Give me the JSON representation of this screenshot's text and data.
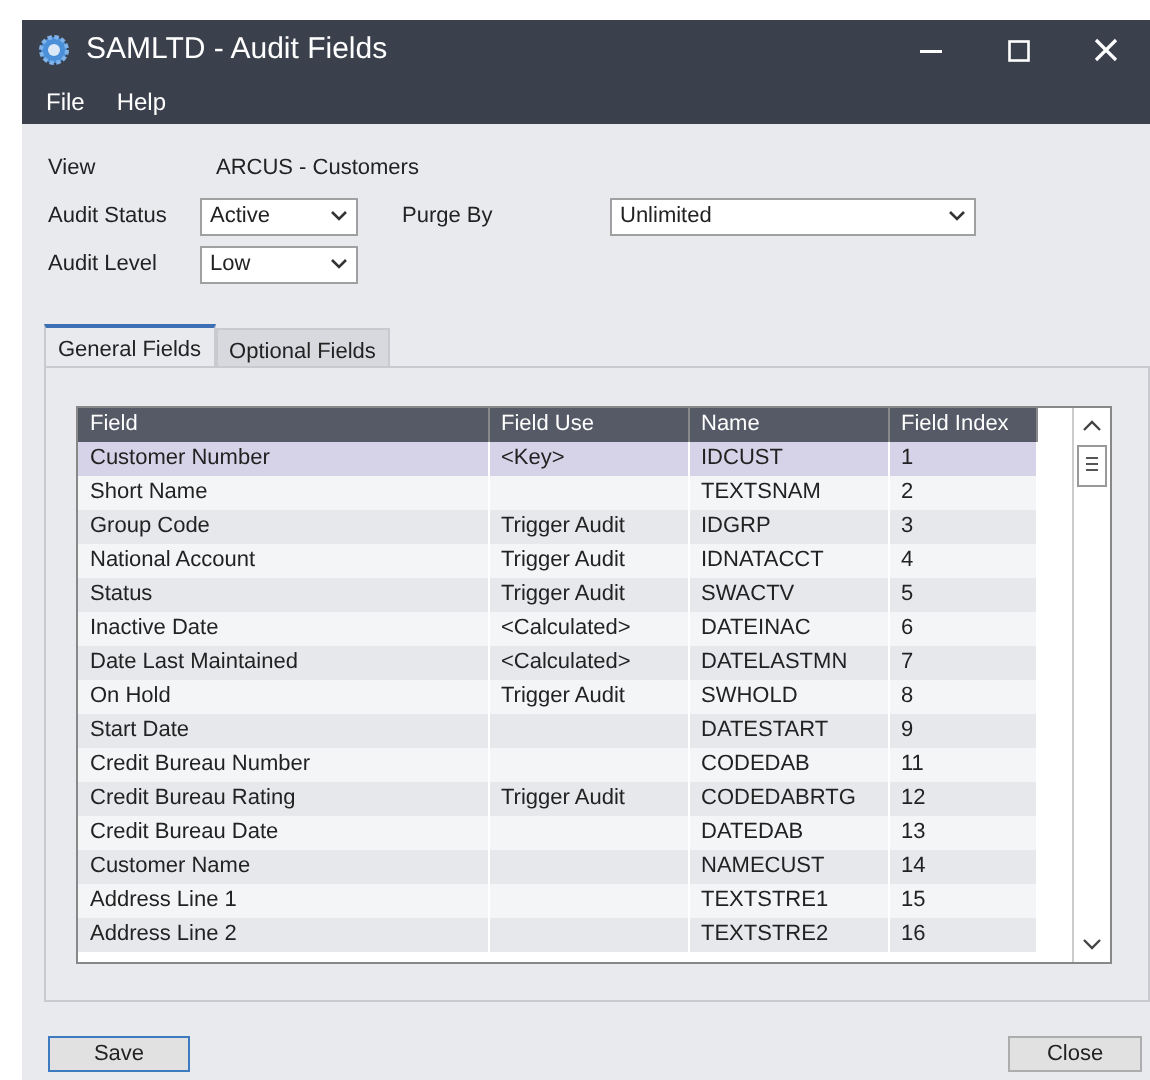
{
  "window": {
    "title": "SAMLTD - Audit Fields"
  },
  "menu": [
    "File",
    "Help"
  ],
  "view": {
    "label": "View",
    "value": "ARCUS - Customers"
  },
  "audit_status": {
    "label": "Audit Status",
    "value": "Active"
  },
  "purge_by": {
    "label": "Purge By",
    "value": "Unlimited"
  },
  "audit_level": {
    "label": "Audit Level",
    "value": "Low"
  },
  "tabs": [
    {
      "label": "General Fields",
      "selected": true
    },
    {
      "label": "Optional Fields",
      "selected": false
    }
  ],
  "table": {
    "columns": [
      "Field",
      "Field Use",
      "Name",
      "Field Index"
    ],
    "rows": [
      {
        "cells": [
          "Customer Number",
          "<Key>",
          "IDCUST",
          "1"
        ],
        "selected": true
      },
      {
        "cells": [
          "Short Name",
          "",
          "TEXTSNAM",
          "2"
        ],
        "selected": false
      },
      {
        "cells": [
          "Group Code",
          "Trigger Audit",
          "IDGRP",
          "3"
        ],
        "selected": false
      },
      {
        "cells": [
          "National Account",
          "Trigger Audit",
          "IDNATACCT",
          "4"
        ],
        "selected": false
      },
      {
        "cells": [
          "Status",
          "Trigger Audit",
          "SWACTV",
          "5"
        ],
        "selected": false
      },
      {
        "cells": [
          "Inactive Date",
          "<Calculated>",
          "DATEINAC",
          "6"
        ],
        "selected": false
      },
      {
        "cells": [
          "Date Last Maintained",
          "<Calculated>",
          "DATELASTMN",
          "7"
        ],
        "selected": false
      },
      {
        "cells": [
          "On Hold",
          "Trigger Audit",
          "SWHOLD",
          "8"
        ],
        "selected": false
      },
      {
        "cells": [
          "Start Date",
          "",
          "DATESTART",
          "9"
        ],
        "selected": false
      },
      {
        "cells": [
          "Credit Bureau Number",
          "",
          "CODEDAB",
          "11"
        ],
        "selected": false
      },
      {
        "cells": [
          "Credit Bureau Rating",
          "Trigger Audit",
          "CODEDABRTG",
          "12"
        ],
        "selected": false
      },
      {
        "cells": [
          "Credit Bureau Date",
          "",
          "DATEDAB",
          "13"
        ],
        "selected": false
      },
      {
        "cells": [
          "Customer Name",
          "",
          "NAMECUST",
          "14"
        ],
        "selected": false
      },
      {
        "cells": [
          "Address Line 1",
          "",
          "TEXTSTRE1",
          "15"
        ],
        "selected": false
      },
      {
        "cells": [
          "Address Line 2",
          "",
          "TEXTSTRE2",
          "16"
        ],
        "selected": false
      }
    ]
  },
  "buttons": [
    "Save",
    "Close"
  ]
}
